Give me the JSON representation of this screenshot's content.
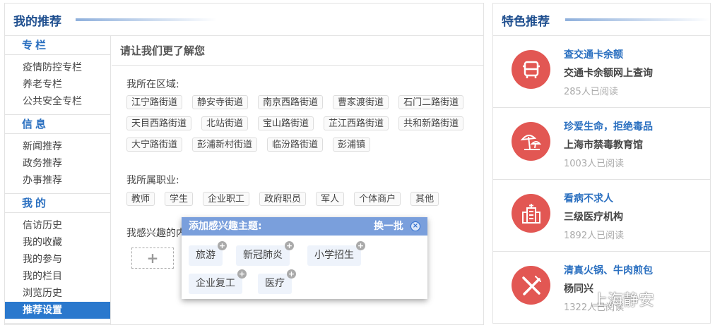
{
  "left": {
    "title": "我的推荐",
    "sidebar": [
      {
        "section": "专栏",
        "items": [
          "疫情防控专栏",
          "养老专栏",
          "公共安全专栏"
        ]
      },
      {
        "section": "信息",
        "items": [
          "新闻推荐",
          "政务推荐",
          "办事推荐"
        ]
      },
      {
        "section": "我的",
        "items": [
          "信访历史",
          "我的收藏",
          "我的参与",
          "我的栏目",
          "浏览历史",
          "推荐设置"
        ]
      }
    ],
    "selected": "推荐设置",
    "main": {
      "title": "请让我们更了解您",
      "region_label": "我所在区域:",
      "regions": [
        "江宁路街道",
        "静安寺街道",
        "南京西路街道",
        "曹家渡街道",
        "石门二路街道",
        "天目西路街道",
        "北站街道",
        "宝山路街道",
        "芷江西路街道",
        "共和新路街道",
        "大宁路街道",
        "彭浦新村街道",
        "临汾路街道",
        "彭浦镇"
      ],
      "job_label": "我所属职业:",
      "jobs": [
        "教师",
        "学生",
        "企业职工",
        "政府职员",
        "军人",
        "个体商户",
        "其他"
      ],
      "interest_label": "我感兴趣的内容:",
      "add_symbol": "+"
    },
    "popup": {
      "title": "添加感兴趣主题:",
      "switch": "换一批",
      "close": "×",
      "topics": [
        "旅游",
        "新冠肺炎",
        "小学招生",
        "企业复工",
        "医疗"
      ]
    }
  },
  "right": {
    "title": "特色推荐",
    "items": [
      {
        "title": "查交通卡余额",
        "subtitle": "交通卡余额网上查询",
        "reads": "285人已阅读",
        "icon": "bus-icon"
      },
      {
        "title": "珍爱生命，拒绝毒品",
        "subtitle": "上海市禁毒教育馆",
        "reads": "1003人已阅读",
        "icon": "umbrella-icon"
      },
      {
        "title": "看病不求人",
        "subtitle": "三级医疗机构",
        "reads": "1892人已阅读",
        "icon": "hospital-icon"
      },
      {
        "title": "清真火锅、牛肉煎包",
        "subtitle": "杨同兴",
        "reads": "1322人已阅读",
        "icon": "fork-knife-icon"
      }
    ]
  },
  "watermark": "上海静安",
  "colors": {
    "accent": "#2a78cd",
    "icon_bg": "#e25753",
    "popup_header": "#7a9fdc"
  }
}
